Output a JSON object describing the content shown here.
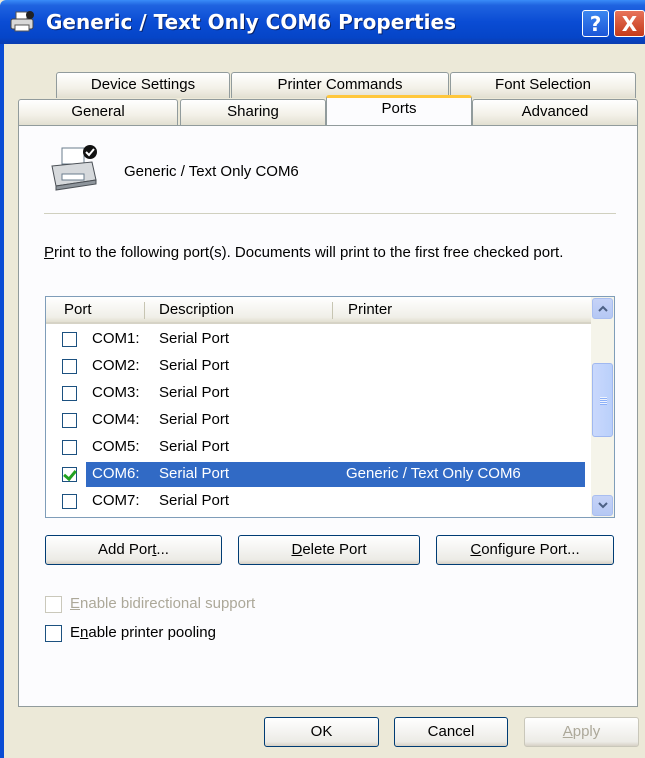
{
  "window": {
    "title": "Generic / Text Only COM6 Properties",
    "help_glyph": "?",
    "close_glyph": "X"
  },
  "tabs": {
    "row1": [
      {
        "label": "Device Settings"
      },
      {
        "label": "Printer Commands"
      },
      {
        "label": "Font Selection"
      }
    ],
    "row2": [
      {
        "label": "General"
      },
      {
        "label": "Sharing"
      },
      {
        "label": "Ports",
        "active": true
      },
      {
        "label": "Advanced"
      }
    ]
  },
  "printer": {
    "name": "Generic / Text Only COM6"
  },
  "description": {
    "mnemonic": "P",
    "text_rest": "rint to the following port(s). Documents will print to the first free checked port."
  },
  "ports_list": {
    "columns": [
      "Port",
      "Description",
      "Printer"
    ],
    "rows": [
      {
        "port": "COM1:",
        "description": "Serial Port",
        "printer": "",
        "checked": false,
        "selected": false
      },
      {
        "port": "COM2:",
        "description": "Serial Port",
        "printer": "",
        "checked": false,
        "selected": false
      },
      {
        "port": "COM3:",
        "description": "Serial Port",
        "printer": "",
        "checked": false,
        "selected": false
      },
      {
        "port": "COM4:",
        "description": "Serial Port",
        "printer": "",
        "checked": false,
        "selected": false
      },
      {
        "port": "COM5:",
        "description": "Serial Port",
        "printer": "",
        "checked": false,
        "selected": false
      },
      {
        "port": "COM6:",
        "description": "Serial Port",
        "printer": "Generic / Text Only COM6",
        "checked": true,
        "selected": true
      },
      {
        "port": "COM7:",
        "description": "Serial Port",
        "printer": "",
        "checked": false,
        "selected": false
      }
    ]
  },
  "port_buttons": {
    "add_pre": "Add Por",
    "add_mn": "t",
    "add_post": "...",
    "delete_mn": "D",
    "delete_post": "elete Port",
    "configure_mn": "C",
    "configure_post": "onfigure Port..."
  },
  "options": {
    "bidirectional": {
      "mn": "E",
      "rest": "nable bidirectional support",
      "checked": false,
      "enabled": false
    },
    "pooling_pre": "E",
    "pooling_mn": "n",
    "pooling_rest": "able printer pooling",
    "pooling_checked": false
  },
  "dialog_buttons": {
    "ok": "OK",
    "cancel": "Cancel",
    "apply_mn": "A",
    "apply_rest": "pply"
  },
  "colors": {
    "titlebar": "#0A4CD4",
    "selection": "#316AC5",
    "active_tab_accent": "#FFC73C"
  },
  "icons": [
    "printer-icon",
    "help-icon",
    "close-icon",
    "scroll-up-icon",
    "scroll-down-icon"
  ]
}
